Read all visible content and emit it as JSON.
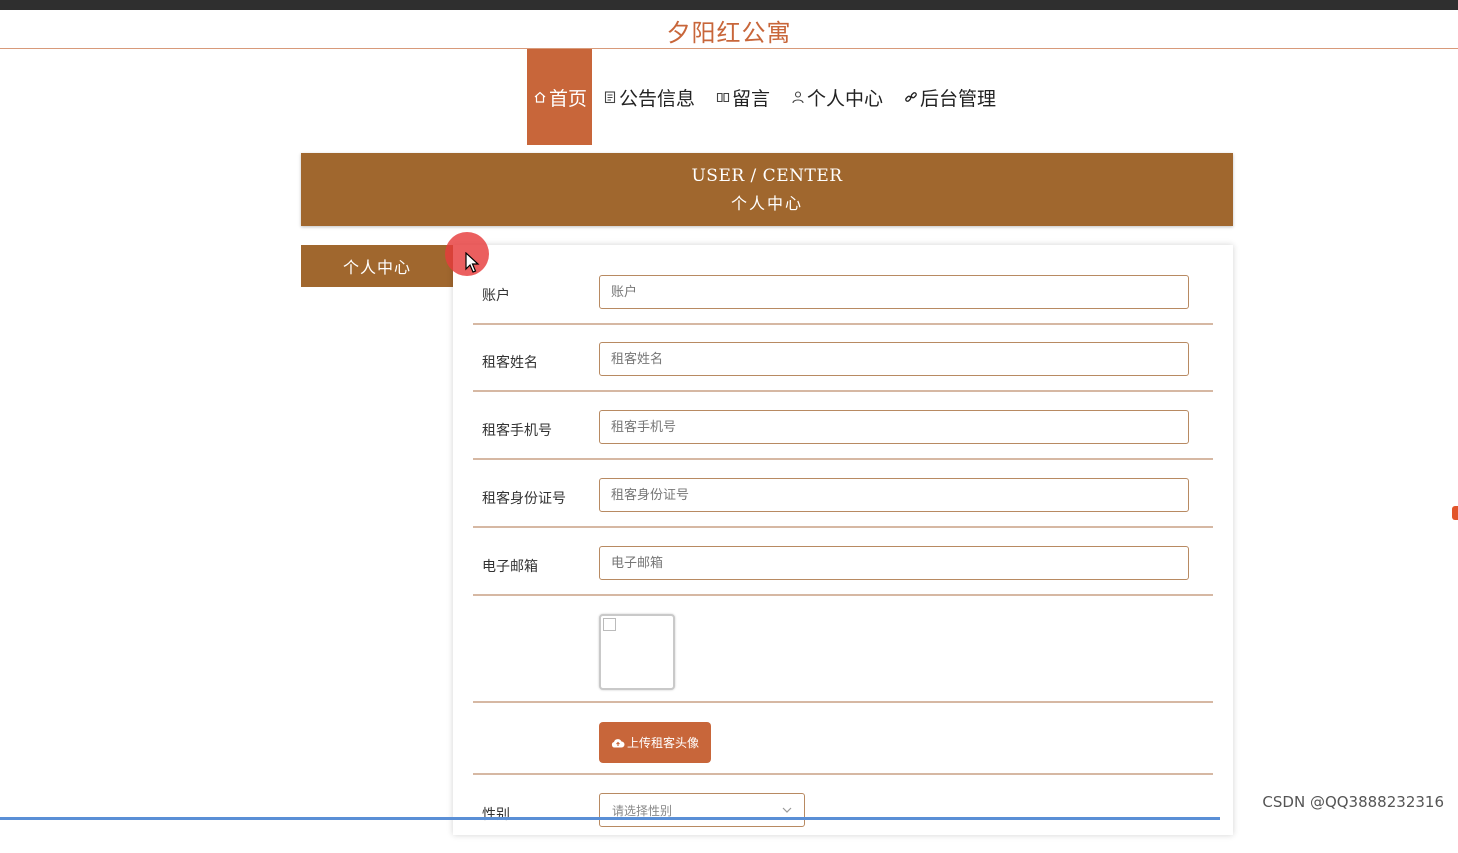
{
  "site": {
    "title": "夕阳红公寓"
  },
  "nav": {
    "items": [
      {
        "label": "首页",
        "icon": "home-icon"
      },
      {
        "label": "公告信息",
        "icon": "notice-icon"
      },
      {
        "label": "留言",
        "icon": "message-icon"
      },
      {
        "label": "个人中心",
        "icon": "user-icon"
      },
      {
        "label": "后台管理",
        "icon": "link-icon"
      }
    ],
    "active": "首页"
  },
  "banner": {
    "en": "USER / CENTER",
    "cn": "个人中心"
  },
  "sidebar": {
    "tab_label": "个人中心"
  },
  "form": {
    "fields": [
      {
        "label": "账户",
        "placeholder": "账户",
        "value": ""
      },
      {
        "label": "租客姓名",
        "placeholder": "租客姓名",
        "value": ""
      },
      {
        "label": "租客手机号",
        "placeholder": "租客手机号",
        "value": ""
      },
      {
        "label": "租客身份证号",
        "placeholder": "租客身份证号",
        "value": ""
      },
      {
        "label": "电子邮箱",
        "placeholder": "电子邮箱",
        "value": ""
      }
    ],
    "upload_label": "上传租客头像",
    "gender": {
      "label": "性别",
      "placeholder": "请选择性别"
    }
  },
  "watermark": "CSDN @QQ3888232316",
  "colors": {
    "accent": "#c8663a",
    "brown": "#a0672e",
    "border": "#b88a62"
  }
}
